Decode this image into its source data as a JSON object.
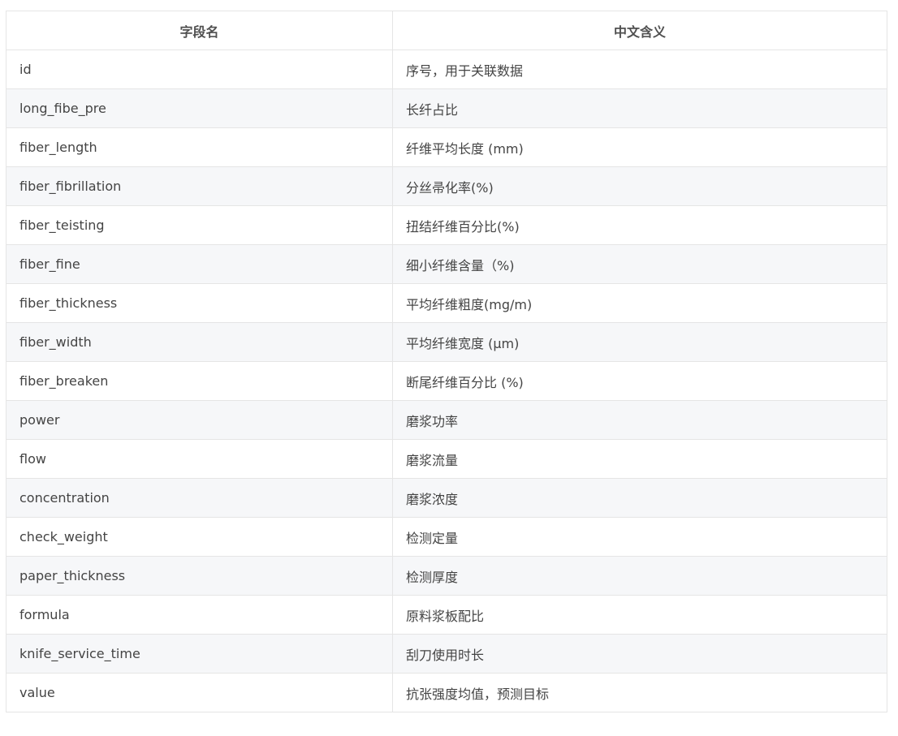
{
  "table": {
    "headers": [
      "字段名",
      "中文含义"
    ],
    "rows": [
      {
        "field": "id",
        "meaning": "序号，用于关联数据"
      },
      {
        "field": "long_fibe_pre",
        "meaning": "长纤占比"
      },
      {
        "field": "fiber_length",
        "meaning": "纤维平均长度 (mm)"
      },
      {
        "field": "fiber_fibrillation",
        "meaning": "分丝帚化率(%)"
      },
      {
        "field": "fiber_teisting",
        "meaning": "扭结纤维百分比(%)"
      },
      {
        "field": "fiber_fine",
        "meaning": "细小纤维含量（%)"
      },
      {
        "field": "fiber_thickness",
        "meaning": "平均纤维粗度(mg/m)"
      },
      {
        "field": "fiber_width",
        "meaning": "平均纤维宽度 (μm)"
      },
      {
        "field": "fiber_breaken",
        "meaning": "断尾纤维百分比 (%)"
      },
      {
        "field": "power",
        "meaning": "磨浆功率"
      },
      {
        "field": "flow",
        "meaning": "磨浆流量"
      },
      {
        "field": "concentration",
        "meaning": "磨浆浓度"
      },
      {
        "field": "check_weight",
        "meaning": "检测定量"
      },
      {
        "field": "paper_thickness",
        "meaning": "检测厚度"
      },
      {
        "field": "formula",
        "meaning": "原料浆板配比"
      },
      {
        "field": "knife_service_time",
        "meaning": "刮刀使用时长"
      },
      {
        "field": "value",
        "meaning": "抗张强度均值，预测目标"
      }
    ]
  }
}
